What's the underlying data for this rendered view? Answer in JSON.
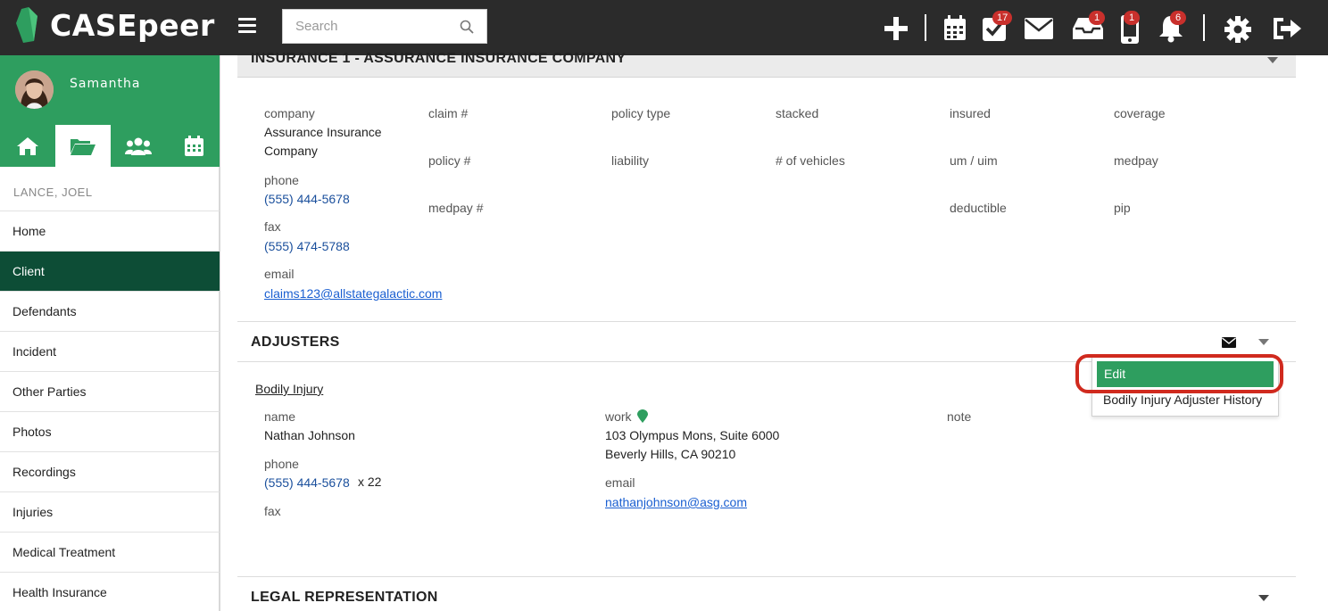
{
  "app": {
    "brand": "CASEpeer"
  },
  "colors": {
    "brand_green": "#2e9e5f",
    "dark_green": "#0d4d36",
    "topbar": "#2b2b2b",
    "badge_red": "#c9302c",
    "link_blue": "#1a4f9c",
    "highlight_red": "#d02a1e"
  },
  "search": {
    "placeholder": "Search"
  },
  "toolbar": {
    "icons": [
      "plus-icon",
      "calendar-icon",
      "tasks-icon",
      "mail-icon",
      "inbox-icon",
      "phone-icon",
      "bell-icon",
      "gear-icon",
      "logout-icon"
    ],
    "badges": {
      "tasks": "17",
      "inbox": "1",
      "phone": "1",
      "notifications": "6"
    }
  },
  "sidebar": {
    "username": "Samantha",
    "tabs": [
      "home-icon",
      "folder-open-icon",
      "users-icon",
      "calendar-icon"
    ],
    "case_name": "LANCE, JOEL",
    "items": [
      {
        "label": "Home"
      },
      {
        "label": "Client"
      },
      {
        "label": "Defendants"
      },
      {
        "label": "Incident"
      },
      {
        "label": "Other Parties"
      },
      {
        "label": "Photos"
      },
      {
        "label": "Recordings"
      },
      {
        "label": "Injuries"
      },
      {
        "label": "Medical Treatment"
      },
      {
        "label": "Health Insurance"
      }
    ]
  },
  "insurance": {
    "title": "INSURANCE 1 - ASSURANCE INSURANCE COMPANY",
    "company_label": "company",
    "company_line1": "Assurance Insurance",
    "company_line2": "Company",
    "phone_label": "phone",
    "phone": "(555) 444-5678",
    "fax_label": "fax",
    "fax": "(555) 474-5788",
    "email_label": "email",
    "email": "claims123@allstategalactic.com",
    "fields": {
      "claim": "claim #",
      "policy_num": "policy #",
      "medpay_num": "medpay #",
      "policy_type": "policy type",
      "liability": "liability",
      "stacked": "stacked",
      "vehicles": "# of vehicles",
      "insured": "insured",
      "um_uim": "um / uim",
      "deductible": "deductible",
      "coverage": "coverage",
      "medpay": "medpay",
      "pip": "pip"
    }
  },
  "adjusters": {
    "title": "ADJUSTERS",
    "type_link": "Bodily Injury",
    "name_label": "name",
    "name": "Nathan Johnson",
    "phone_label": "phone",
    "phone": "(555) 444-5678",
    "phone_ext": "x 22",
    "fax_label": "fax",
    "work_label": "work",
    "address_line1": "103 Olympus Mons, Suite 6000",
    "address_line2": "Beverly Hills, CA 90210",
    "email_label": "email",
    "email": "nathanjohnson@asg.com",
    "note_label": "note",
    "menu": {
      "edit": "Edit",
      "history": "Bodily Injury Adjuster History"
    }
  },
  "legal": {
    "title": "LEGAL REPRESENTATION"
  }
}
